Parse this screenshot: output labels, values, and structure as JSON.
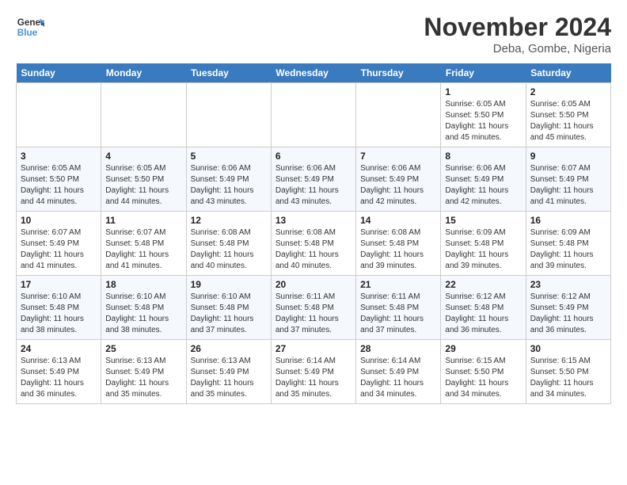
{
  "header": {
    "logo_line1": "General",
    "logo_line2": "Blue",
    "month_title": "November 2024",
    "location": "Deba, Gombe, Nigeria"
  },
  "days_of_week": [
    "Sunday",
    "Monday",
    "Tuesday",
    "Wednesday",
    "Thursday",
    "Friday",
    "Saturday"
  ],
  "weeks": [
    [
      {
        "day": "",
        "info": ""
      },
      {
        "day": "",
        "info": ""
      },
      {
        "day": "",
        "info": ""
      },
      {
        "day": "",
        "info": ""
      },
      {
        "day": "",
        "info": ""
      },
      {
        "day": "1",
        "info": "Sunrise: 6:05 AM\nSunset: 5:50 PM\nDaylight: 11 hours\nand 45 minutes."
      },
      {
        "day": "2",
        "info": "Sunrise: 6:05 AM\nSunset: 5:50 PM\nDaylight: 11 hours\nand 45 minutes."
      }
    ],
    [
      {
        "day": "3",
        "info": "Sunrise: 6:05 AM\nSunset: 5:50 PM\nDaylight: 11 hours\nand 44 minutes."
      },
      {
        "day": "4",
        "info": "Sunrise: 6:05 AM\nSunset: 5:50 PM\nDaylight: 11 hours\nand 44 minutes."
      },
      {
        "day": "5",
        "info": "Sunrise: 6:06 AM\nSunset: 5:49 PM\nDaylight: 11 hours\nand 43 minutes."
      },
      {
        "day": "6",
        "info": "Sunrise: 6:06 AM\nSunset: 5:49 PM\nDaylight: 11 hours\nand 43 minutes."
      },
      {
        "day": "7",
        "info": "Sunrise: 6:06 AM\nSunset: 5:49 PM\nDaylight: 11 hours\nand 42 minutes."
      },
      {
        "day": "8",
        "info": "Sunrise: 6:06 AM\nSunset: 5:49 PM\nDaylight: 11 hours\nand 42 minutes."
      },
      {
        "day": "9",
        "info": "Sunrise: 6:07 AM\nSunset: 5:49 PM\nDaylight: 11 hours\nand 41 minutes."
      }
    ],
    [
      {
        "day": "10",
        "info": "Sunrise: 6:07 AM\nSunset: 5:49 PM\nDaylight: 11 hours\nand 41 minutes."
      },
      {
        "day": "11",
        "info": "Sunrise: 6:07 AM\nSunset: 5:48 PM\nDaylight: 11 hours\nand 41 minutes."
      },
      {
        "day": "12",
        "info": "Sunrise: 6:08 AM\nSunset: 5:48 PM\nDaylight: 11 hours\nand 40 minutes."
      },
      {
        "day": "13",
        "info": "Sunrise: 6:08 AM\nSunset: 5:48 PM\nDaylight: 11 hours\nand 40 minutes."
      },
      {
        "day": "14",
        "info": "Sunrise: 6:08 AM\nSunset: 5:48 PM\nDaylight: 11 hours\nand 39 minutes."
      },
      {
        "day": "15",
        "info": "Sunrise: 6:09 AM\nSunset: 5:48 PM\nDaylight: 11 hours\nand 39 minutes."
      },
      {
        "day": "16",
        "info": "Sunrise: 6:09 AM\nSunset: 5:48 PM\nDaylight: 11 hours\nand 39 minutes."
      }
    ],
    [
      {
        "day": "17",
        "info": "Sunrise: 6:10 AM\nSunset: 5:48 PM\nDaylight: 11 hours\nand 38 minutes."
      },
      {
        "day": "18",
        "info": "Sunrise: 6:10 AM\nSunset: 5:48 PM\nDaylight: 11 hours\nand 38 minutes."
      },
      {
        "day": "19",
        "info": "Sunrise: 6:10 AM\nSunset: 5:48 PM\nDaylight: 11 hours\nand 37 minutes."
      },
      {
        "day": "20",
        "info": "Sunrise: 6:11 AM\nSunset: 5:48 PM\nDaylight: 11 hours\nand 37 minutes."
      },
      {
        "day": "21",
        "info": "Sunrise: 6:11 AM\nSunset: 5:48 PM\nDaylight: 11 hours\nand 37 minutes."
      },
      {
        "day": "22",
        "info": "Sunrise: 6:12 AM\nSunset: 5:48 PM\nDaylight: 11 hours\nand 36 minutes."
      },
      {
        "day": "23",
        "info": "Sunrise: 6:12 AM\nSunset: 5:49 PM\nDaylight: 11 hours\nand 36 minutes."
      }
    ],
    [
      {
        "day": "24",
        "info": "Sunrise: 6:13 AM\nSunset: 5:49 PM\nDaylight: 11 hours\nand 36 minutes."
      },
      {
        "day": "25",
        "info": "Sunrise: 6:13 AM\nSunset: 5:49 PM\nDaylight: 11 hours\nand 35 minutes."
      },
      {
        "day": "26",
        "info": "Sunrise: 6:13 AM\nSunset: 5:49 PM\nDaylight: 11 hours\nand 35 minutes."
      },
      {
        "day": "27",
        "info": "Sunrise: 6:14 AM\nSunset: 5:49 PM\nDaylight: 11 hours\nand 35 minutes."
      },
      {
        "day": "28",
        "info": "Sunrise: 6:14 AM\nSunset: 5:49 PM\nDaylight: 11 hours\nand 34 minutes."
      },
      {
        "day": "29",
        "info": "Sunrise: 6:15 AM\nSunset: 5:50 PM\nDaylight: 11 hours\nand 34 minutes."
      },
      {
        "day": "30",
        "info": "Sunrise: 6:15 AM\nSunset: 5:50 PM\nDaylight: 11 hours\nand 34 minutes."
      }
    ]
  ]
}
